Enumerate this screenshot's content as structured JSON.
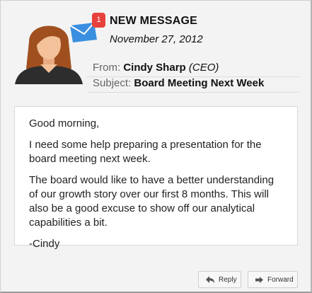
{
  "message": {
    "badge_count": "1",
    "title": "NEW MESSAGE",
    "date": "November 27, 2012",
    "from_label": "From:",
    "from_name": "Cindy Sharp",
    "from_role": "(CEO)",
    "subject_label": "Subject:",
    "subject_text": "Board Meeting Next Week"
  },
  "body": {
    "paragraphs": [
      "Good morning,",
      "I need some help preparing a presentation for the board  meeting next week.",
      "The board would like to have a better understanding of our  growth story over our first 8 months. This will also be a  good excuse to show off our analytical capabilities a bit.",
      "-Cindy"
    ]
  },
  "actions": {
    "reply_label": "Reply",
    "forward_label": "Forward"
  },
  "icons": {
    "avatar": "avatar-woman-icon",
    "mail": "envelope-icon",
    "reply": "reply-arrow-icon",
    "forward": "forward-arrow-icon"
  },
  "colors": {
    "badge": "#e8413d",
    "mail_icon": "#3a8fe0",
    "hair": "#a0501f",
    "skin": "#f4c29a",
    "shirt": "#2d2d2d"
  }
}
